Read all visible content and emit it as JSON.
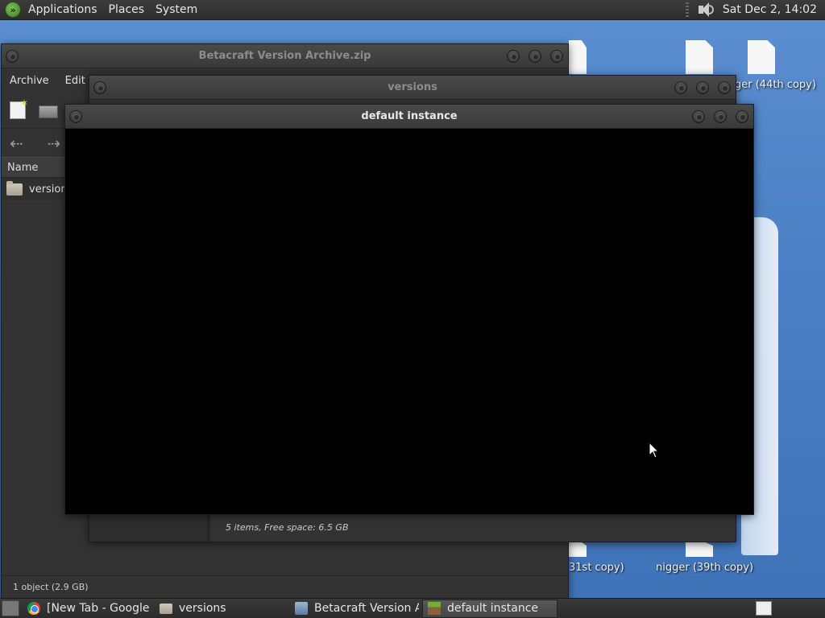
{
  "top_panel": {
    "menus": [
      "Applications",
      "Places",
      "System"
    ],
    "clock": "Sat Dec  2, 14:02",
    "logo_icon": "mint-logo-icon",
    "volume_icon": "speaker-icon"
  },
  "desktop": {
    "label_top_right": "ger (44th copy)",
    "label_bottom_mid": "31st copy)",
    "label_bottom_right": "nigger (39th copy)"
  },
  "archive_window": {
    "title": "Betacraft Version Archive.zip",
    "menus": [
      "Archive",
      "Edit"
    ],
    "column_name": "Name",
    "rows": [
      {
        "name": "versions"
      }
    ],
    "status": "1 object (2.9 GB)"
  },
  "versions_window": {
    "title": "versions",
    "status": "5 items, Free space: 6.5 GB"
  },
  "default_window": {
    "title": "default instance"
  },
  "taskbar": {
    "tasks": [
      {
        "label": "[New Tab - Google ...",
        "icon": "chrome-icon",
        "active": false
      },
      {
        "label": "versions",
        "icon": "folder-icon",
        "active": false
      },
      {
        "label": "Betacraft Version Ar...",
        "icon": "archive-icon",
        "active": false
      },
      {
        "label": "default instance",
        "icon": "minecraft-grass-icon",
        "active": true
      }
    ]
  },
  "colors": {
    "panel": "#2d2d2d",
    "desktop": "#4f82c4",
    "window": "#3a3a3a"
  }
}
